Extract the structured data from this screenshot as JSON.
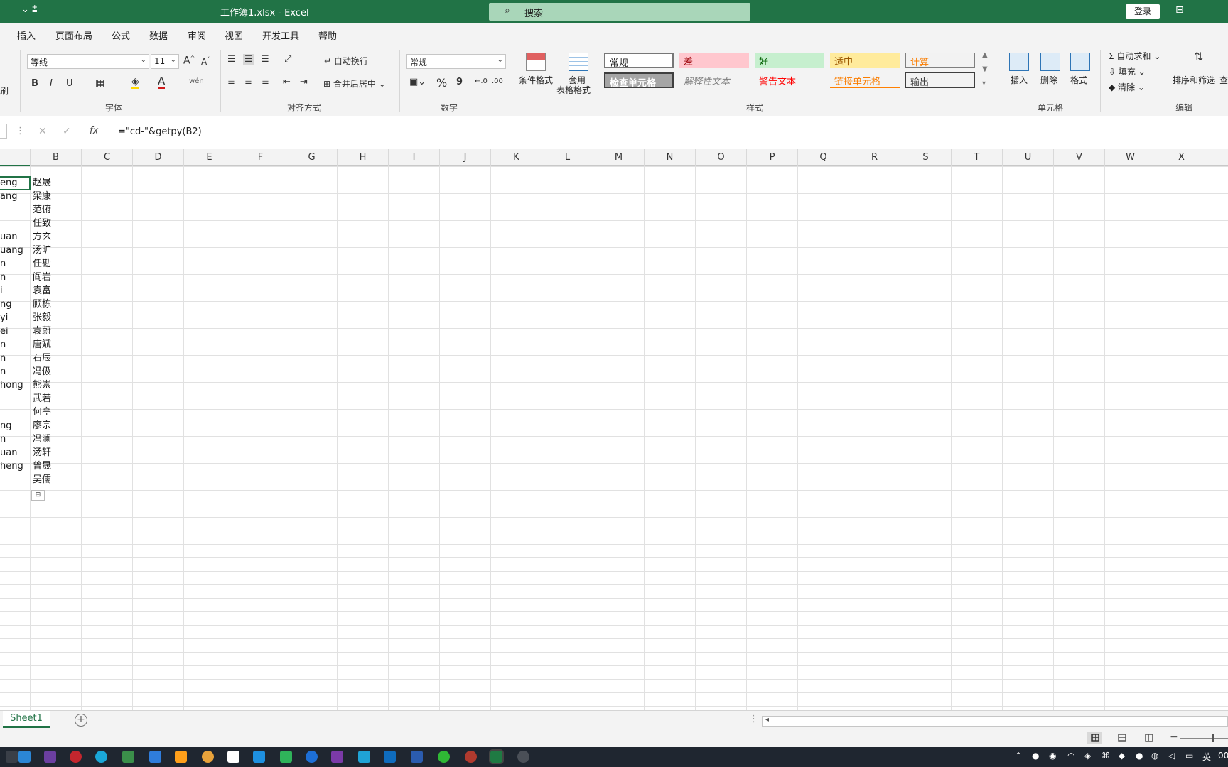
{
  "titlebar": {
    "title": "工作簿1.xlsx  -  Excel",
    "qat": "⌄   ⩲",
    "search_placeholder": "搜索",
    "login_label": "登录"
  },
  "menu": {
    "tabs": [
      "插入",
      "页面布局",
      "公式",
      "数据",
      "审阅",
      "视图",
      "开发工具",
      "帮助"
    ]
  },
  "ribbon": {
    "font_name": "等线",
    "font_size": "11",
    "bold": "B",
    "italic": "I",
    "underline": "U",
    "wrap_text": "自动换行",
    "merge_center": "合并后居中",
    "number_format": "常规",
    "percent": "%",
    "comma": "9",
    "cond_format": "条件格式",
    "table_format_1": "套用",
    "table_format_2": "表格格式",
    "styles": {
      "normal": "常规",
      "bad": "差",
      "good": "好",
      "neutral": "适中",
      "calc": "计算",
      "check": "检查单元格",
      "explanatory": "解释性文本",
      "warning": "警告文本",
      "linked": "链接单元格",
      "output": "输出"
    },
    "insert": "插入",
    "delete": "删除",
    "format": "格式",
    "autosum": "自动求和",
    "fill": "填充",
    "clear": "清除",
    "sort_filter": "排序和筛选",
    "find": "查",
    "brush": "刷",
    "groups": {
      "font": "字体",
      "align": "对齐方式",
      "number": "数字",
      "styles": "样式",
      "cells": "单元格",
      "edit": "编辑"
    }
  },
  "formula_bar": {
    "fx": "fx",
    "formula": "=\"cd-\"&getpy(B2)"
  },
  "columns": [
    "B",
    "C",
    "D",
    "E",
    "F",
    "G",
    "H",
    "I",
    "J",
    "K",
    "L",
    "M",
    "N",
    "O",
    "P",
    "Q",
    "R",
    "S",
    "T",
    "U",
    "V",
    "W",
    "X"
  ],
  "rows": [
    {
      "a": "eng",
      "b": "赵晟"
    },
    {
      "a": "ang",
      "b": "梁康"
    },
    {
      "a": "",
      "b": "范俯"
    },
    {
      "a": "",
      "b": "任致"
    },
    {
      "a": "uan",
      "b": "方玄"
    },
    {
      "a": "uang",
      "b": "汤旷"
    },
    {
      "a": "n",
      "b": "任勘"
    },
    {
      "a": "n",
      "b": "阎岩"
    },
    {
      "a": "i",
      "b": "袁富"
    },
    {
      "a": "ng",
      "b": "顾栋"
    },
    {
      "a": "yi",
      "b": "张毅"
    },
    {
      "a": "ei",
      "b": "袁蔚"
    },
    {
      "a": "n",
      "b": "唐斌"
    },
    {
      "a": "n",
      "b": "石辰"
    },
    {
      "a": "n",
      "b": "冯伋"
    },
    {
      "a": "hong",
      "b": "熊崇"
    },
    {
      "a": "",
      "b": "武若"
    },
    {
      "a": "",
      "b": "何亭"
    },
    {
      "a": "ng",
      "b": "廖宗"
    },
    {
      "a": "n",
      "b": "冯澜"
    },
    {
      "a": "uan",
      "b": "汤轩"
    },
    {
      "a": "heng",
      "b": "曾晟"
    },
    {
      "a": "",
      "b": "吴儒"
    }
  ],
  "sheet": {
    "tab_label": "Sheet1",
    "add_label": "+"
  },
  "status": {
    "zoom_minus": "−"
  },
  "tray": {
    "lang": "英",
    "clock": "00"
  }
}
